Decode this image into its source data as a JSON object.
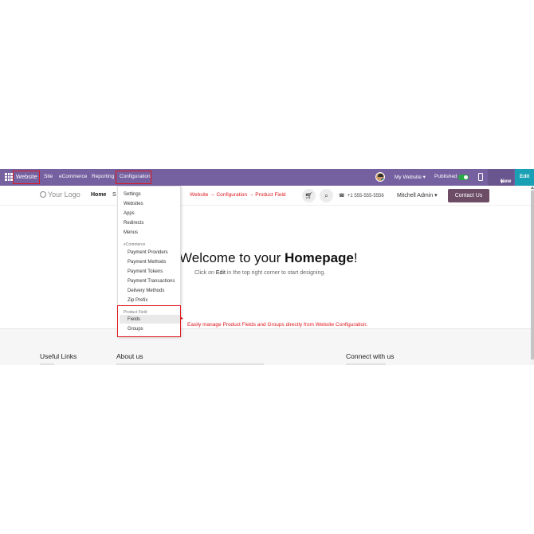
{
  "topbar": {
    "brand": "Website",
    "menu": [
      "Site",
      "eCommerce",
      "Reporting",
      "Configuration"
    ],
    "my_website": "My Website",
    "published": "Published",
    "new_label": "New",
    "edit_label": "Edit",
    "colors": {
      "bar": "#7560a0",
      "highlight": "#e0181e",
      "edit": "#19a0b5"
    }
  },
  "header": {
    "logo": "Your Logo",
    "nav_home": "Home",
    "nav_partial": "S",
    "breadcrumb_note": "Website → Configuration → Product Field",
    "phone": "+1 555-555-5556",
    "user": "Mitchell Admin",
    "contact_button": "Contact Us"
  },
  "dropdown": {
    "top_items": [
      "Settings",
      "Websites",
      "Apps",
      "Redirects",
      "Menus"
    ],
    "ecommerce_header": "eCommerce",
    "ecommerce_items": [
      "Payment Providers",
      "Payment Methods",
      "Payment Tokens",
      "Payment Transactions",
      "Delivery Methods",
      "Zip Prefix"
    ],
    "product_field_header": "Product Field",
    "product_field_items": [
      "Fields",
      "Groups"
    ]
  },
  "hero": {
    "title_prefix": "Welcome to your ",
    "title_bold": "Homepage",
    "title_suffix": "!",
    "sub_prefix": "Click on ",
    "sub_edit": "Edit",
    "sub_suffix": " in the top right corner to start designing."
  },
  "annotation": "Easily manage Product Fields and Groups directly from Website Configuration.",
  "footer": {
    "useful_links": "Useful Links",
    "about_us": "About us",
    "connect": "Connect with us"
  }
}
